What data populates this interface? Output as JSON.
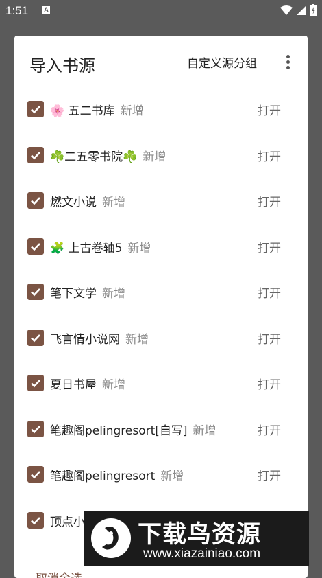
{
  "status_bar": {
    "time": "1:51",
    "notification_letter": "A"
  },
  "dialog": {
    "title": "导入书源",
    "custom_group_label": "自定义源分组",
    "cancel_all_label": "取消全选",
    "open_label": "打开",
    "new_label": "新增",
    "items": [
      {
        "name": "🌸 五二书库",
        "status": "新增",
        "checked": true
      },
      {
        "name": "☘️二五零书院☘️",
        "status": "新增",
        "checked": true
      },
      {
        "name": "燃文小说",
        "status": "新增",
        "checked": true
      },
      {
        "name": "🧩 上古卷轴5",
        "status": "新增",
        "checked": true
      },
      {
        "name": "笔下文学",
        "status": "新增",
        "checked": true
      },
      {
        "name": "飞言情小说网",
        "status": "新增",
        "checked": true
      },
      {
        "name": "夏日书屋",
        "status": "新增",
        "checked": true
      },
      {
        "name": "笔趣阁pelingresort[自写]",
        "status": "新增",
        "checked": true
      },
      {
        "name": "笔趣阁pelingresort",
        "status": "新增",
        "checked": true
      },
      {
        "name": "顶点小",
        "status": "",
        "checked": true
      }
    ]
  },
  "watermark": {
    "title": "下载鸟资源",
    "url": "www.xiazainiao.com"
  },
  "colors": {
    "accent": "#7b5444",
    "overlay": "#5a5a5a"
  }
}
